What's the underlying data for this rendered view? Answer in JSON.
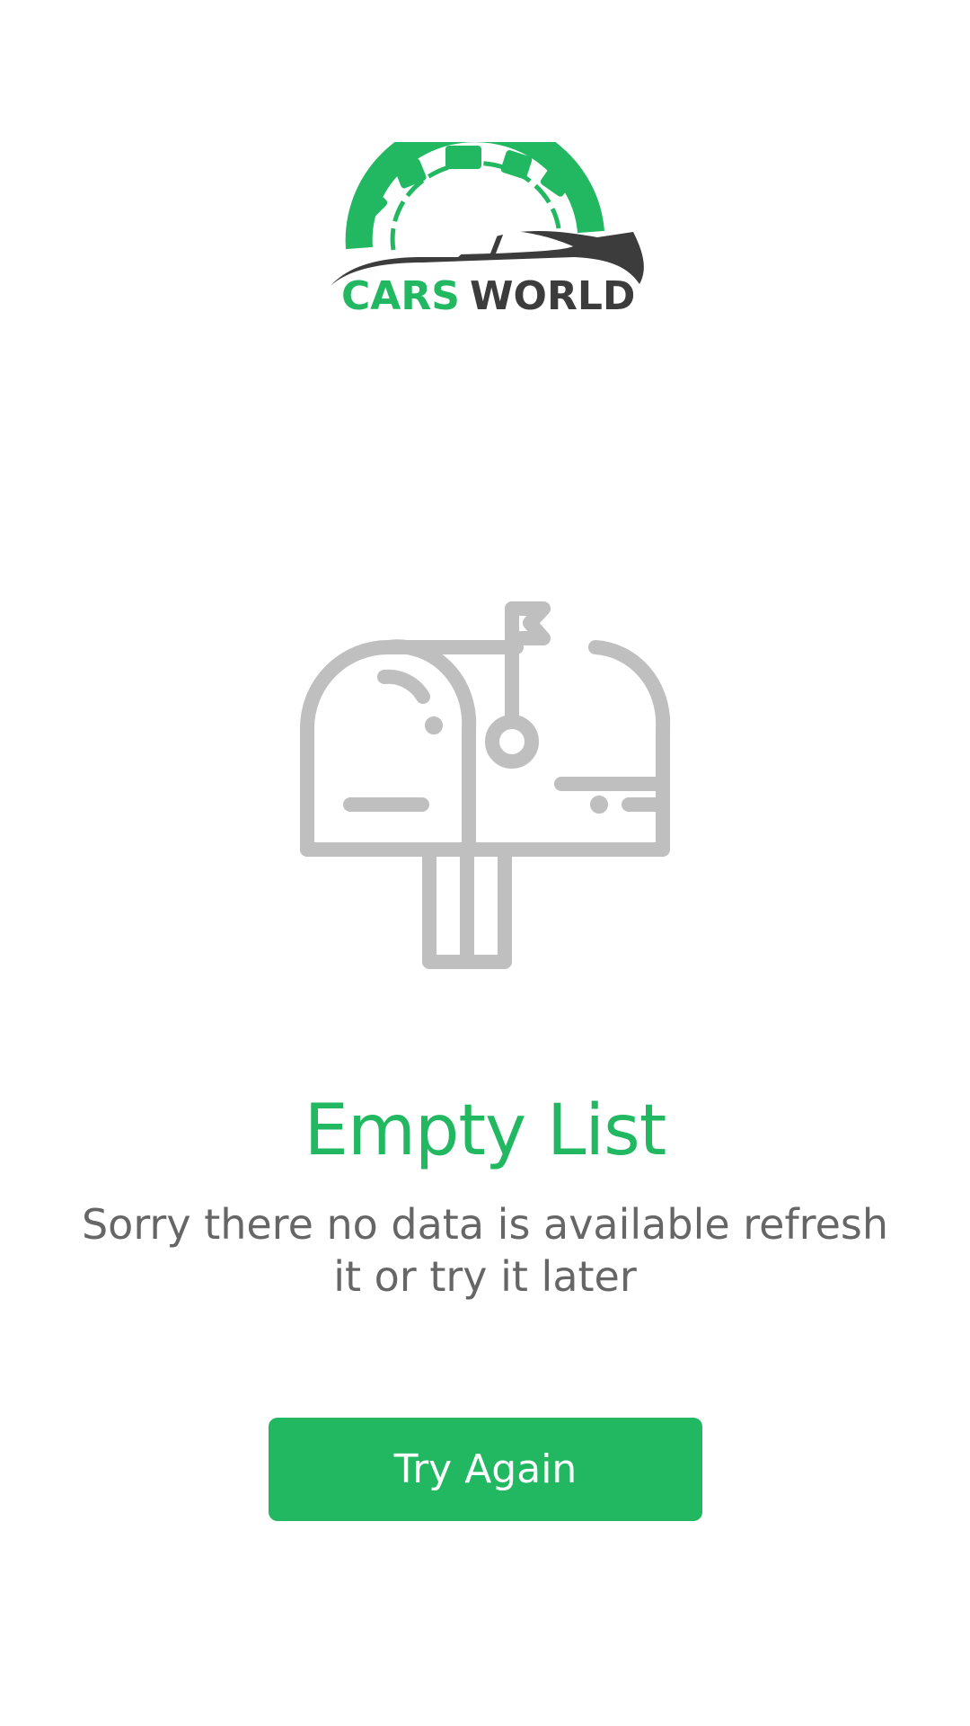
{
  "logo": {
    "brand_first": "CARS",
    "brand_second": "WORLD",
    "colors": {
      "green": "#21b861",
      "dark": "#3c3c3c"
    }
  },
  "empty_state": {
    "icon": "mailbox-icon",
    "title": "Empty List",
    "message": "Sorry there no data is available refresh it or try it later"
  },
  "actions": {
    "try_again_label": "Try Again"
  },
  "colors": {
    "accent": "#21b861",
    "icon_gray": "#bfbfbf",
    "text_gray": "#666666",
    "background": "#ffffff"
  }
}
